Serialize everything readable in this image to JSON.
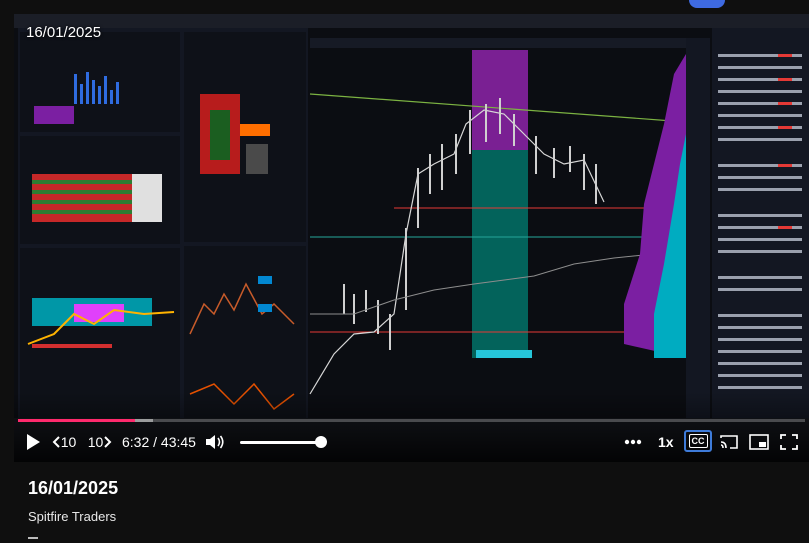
{
  "video": {
    "overlay_date": "16/01/2025",
    "current_time": "6:32",
    "duration": "43:45",
    "time_display": "6:32 / 43:45",
    "progress_fraction": 0.149,
    "buffer_fraction": 0.172,
    "volume_fraction": 1.0,
    "speed": "1x",
    "rewind_label": "10",
    "forward_label": "10",
    "accent_color": "#ff2a6d"
  },
  "controls": {
    "play_icon": "play-icon",
    "rewind_icon": "rewind-10-icon",
    "forward_icon": "forward-10-icon",
    "volume_icon": "volume-icon",
    "more_icon": "more-icon",
    "cc_label": "CC",
    "cast_icon": "cast-icon",
    "miniplayer_icon": "miniplayer-icon",
    "fullscreen_icon": "fullscreen-icon"
  },
  "details": {
    "title": "16/01/2025",
    "channel": "Spitfire Traders"
  }
}
